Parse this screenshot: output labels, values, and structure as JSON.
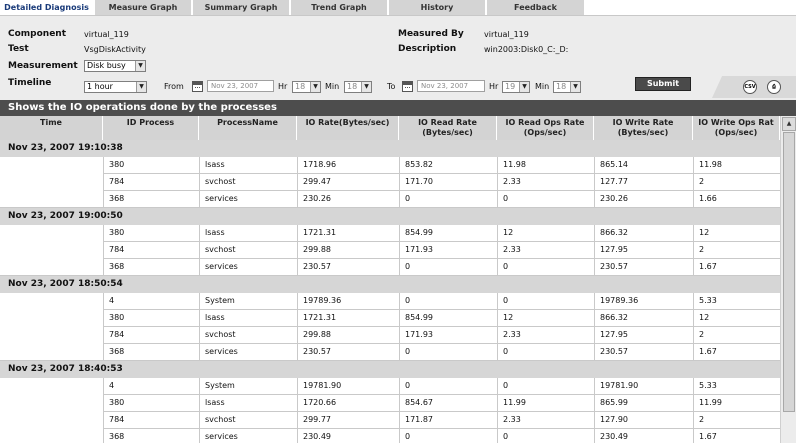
{
  "tabs": [
    {
      "label": "Detailed Diagnosis",
      "active": true
    },
    {
      "label": "Measure Graph"
    },
    {
      "label": "Summary Graph"
    },
    {
      "label": "Trend Graph"
    },
    {
      "label": "History"
    },
    {
      "label": "Feedback"
    }
  ],
  "filter": {
    "component_label": "Component",
    "component_value": "virtual_119",
    "test_label": "Test",
    "test_value": "VsgDiskActivity",
    "measurement_label": "Measurement",
    "measurement_value": "Disk busy",
    "timeline_label": "Timeline",
    "timeline_value": "1 hour",
    "measured_by_label": "Measured By",
    "measured_by_value": "virtual_119",
    "description_label": "Description",
    "description_value": "win2003:Disk0_C:_D:",
    "from_label": "From",
    "from_date": "Nov 23, 2007",
    "from_hr_label": "Hr",
    "from_hr": "18",
    "from_min_label": "Min",
    "from_min": "18",
    "to_label": "To",
    "to_date": "Nov 23, 2007",
    "to_hr_label": "Hr",
    "to_hr": "19",
    "to_min_label": "Min",
    "to_min": "18",
    "submit_label": "Submit",
    "csv_icon_text": "CSV"
  },
  "section_title": "Shows the IO operations done by the processes",
  "columns": [
    "Time",
    "ID Process",
    "ProcessName",
    "IO Rate(Bytes/sec)",
    "IO Read Rate\n(Bytes/sec)",
    "IO Read Ops Rate\n(Ops/sec)",
    "IO Write Rate\n(Bytes/sec)",
    "IO Write Ops Rat\n(Ops/sec)"
  ],
  "groups": [
    {
      "time": "Nov 23, 2007 19:10:38",
      "rows": [
        [
          "380",
          "lsass",
          "1718.96",
          "853.82",
          "11.98",
          "865.14",
          "11.98"
        ],
        [
          "784",
          "svchost",
          "299.47",
          "171.70",
          "2.33",
          "127.77",
          "2"
        ],
        [
          "368",
          "services",
          "230.26",
          "0",
          "0",
          "230.26",
          "1.66"
        ]
      ]
    },
    {
      "time": "Nov 23, 2007 19:00:50",
      "rows": [
        [
          "380",
          "lsass",
          "1721.31",
          "854.99",
          "12",
          "866.32",
          "12"
        ],
        [
          "784",
          "svchost",
          "299.88",
          "171.93",
          "2.33",
          "127.95",
          "2"
        ],
        [
          "368",
          "services",
          "230.57",
          "0",
          "0",
          "230.57",
          "1.67"
        ]
      ]
    },
    {
      "time": "Nov 23, 2007 18:50:54",
      "rows": [
        [
          "4",
          "System",
          "19789.36",
          "0",
          "0",
          "19789.36",
          "5.33"
        ],
        [
          "380",
          "lsass",
          "1721.31",
          "854.99",
          "12",
          "866.32",
          "12"
        ],
        [
          "784",
          "svchost",
          "299.88",
          "171.93",
          "2.33",
          "127.95",
          "2"
        ],
        [
          "368",
          "services",
          "230.57",
          "0",
          "0",
          "230.57",
          "1.67"
        ]
      ]
    },
    {
      "time": "Nov 23, 2007 18:40:53",
      "rows": [
        [
          "4",
          "System",
          "19781.90",
          "0",
          "0",
          "19781.90",
          "5.33"
        ],
        [
          "380",
          "lsass",
          "1720.66",
          "854.67",
          "11.99",
          "865.99",
          "11.99"
        ],
        [
          "784",
          "svchost",
          "299.77",
          "171.87",
          "2.33",
          "127.90",
          "2"
        ],
        [
          "368",
          "services",
          "230.49",
          "0",
          "0",
          "230.49",
          "1.67"
        ]
      ]
    }
  ]
}
